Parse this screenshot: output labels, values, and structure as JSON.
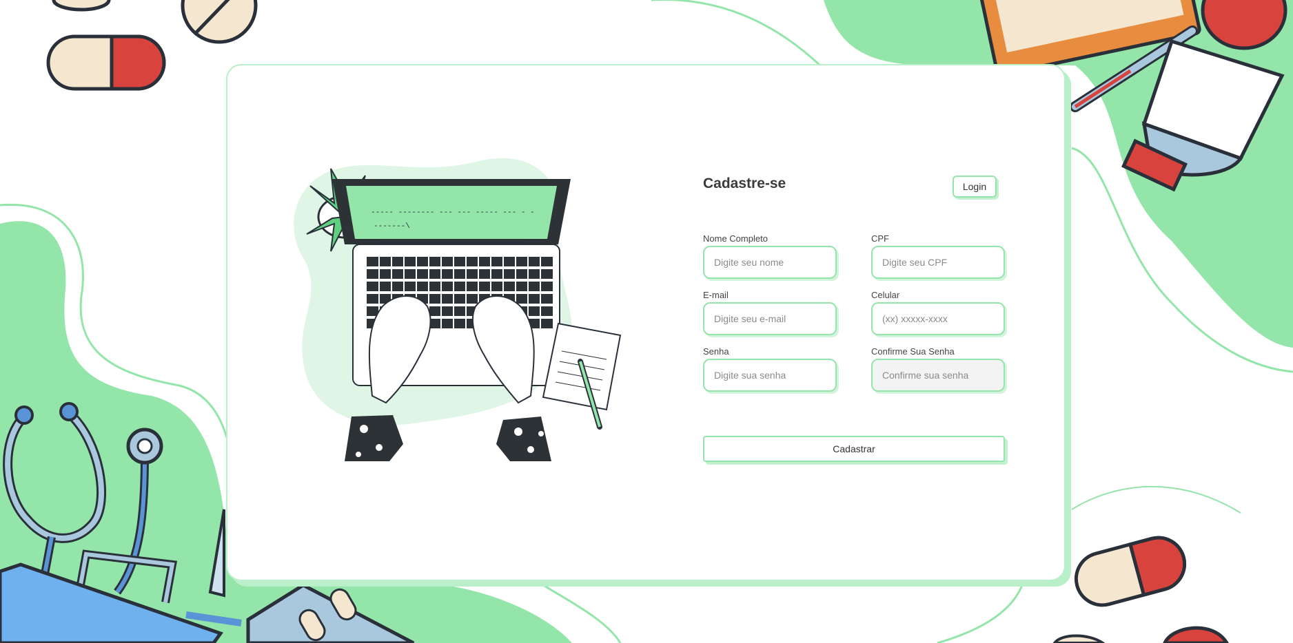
{
  "form": {
    "title": "Cadastre-se",
    "login_label": "Login",
    "submit_label": "Cadastrar",
    "fields": {
      "name": {
        "label": "Nome Completo",
        "placeholder": "Digite seu nome"
      },
      "cpf": {
        "label": "CPF",
        "placeholder": "Digite seu CPF"
      },
      "email": {
        "label": "E-mail",
        "placeholder": "Digite seu e-mail"
      },
      "phone": {
        "label": "Celular",
        "placeholder": "(xx) xxxxx-xxxx"
      },
      "password": {
        "label": "Senha",
        "placeholder": "Digite sua senha"
      },
      "confirm": {
        "label": "Confirme Sua Senha",
        "placeholder": "Confirme sua senha"
      }
    }
  },
  "illustration": {
    "screen_text_1": "----- -------- --- ---    ----- --- - -",
    "screen_text_2": "-------\\"
  },
  "colors": {
    "accent_green": "#93e5a9",
    "card_border": "#b9efc9",
    "background_blob": "#93e5a9",
    "pill_red": "#d8433e",
    "pill_cream": "#f5e6cf",
    "outline_dark": "#2a303a"
  },
  "icons": [
    "laptop-illustration",
    "plant-icon",
    "notepad-icon",
    "pencil-icon",
    "stethoscope-icon",
    "pill-icon",
    "thermometer-icon",
    "bottle-icon",
    "clipboard-icon",
    "medical-bag-icon"
  ]
}
